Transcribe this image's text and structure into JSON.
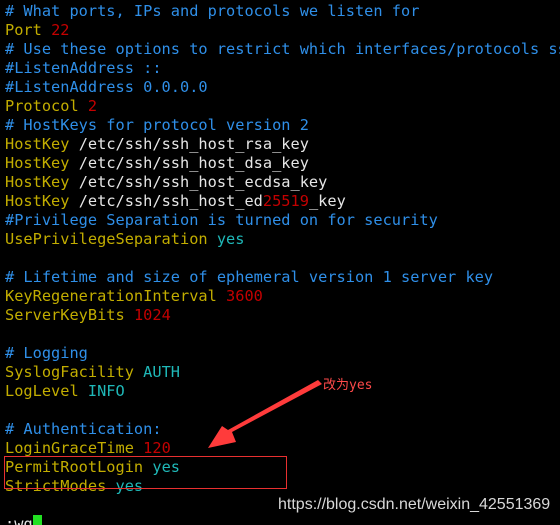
{
  "editor": {
    "lines": [
      [
        [
          "# What ports, IPs and protocols we listen for",
          "comment"
        ]
      ],
      [
        [
          "Port ",
          "keyword"
        ],
        [
          "22",
          "number"
        ]
      ],
      [
        [
          "# Use these options to restrict which interfaces/protocols sshd will bind to",
          "comment"
        ]
      ],
      [
        [
          "#ListenAddress ::",
          "comment"
        ]
      ],
      [
        [
          "#ListenAddress 0.0.0.0",
          "comment"
        ]
      ],
      [
        [
          "Protocol ",
          "keyword"
        ],
        [
          "2",
          "number"
        ]
      ],
      [
        [
          "# HostKeys for protocol version 2",
          "comment"
        ]
      ],
      [
        [
          "HostKey ",
          "keyword"
        ],
        [
          "/etc/ssh/ssh_host_rsa_key",
          "plain"
        ]
      ],
      [
        [
          "HostKey ",
          "keyword"
        ],
        [
          "/etc/ssh/ssh_host_dsa_key",
          "plain"
        ]
      ],
      [
        [
          "HostKey ",
          "keyword"
        ],
        [
          "/etc/ssh/ssh_host_ecdsa_key",
          "plain"
        ]
      ],
      [
        [
          "HostKey ",
          "keyword"
        ],
        [
          "/etc/ssh/ssh_host_ed",
          "plain"
        ],
        [
          "25519",
          "number"
        ],
        [
          "_key",
          "plain"
        ]
      ],
      [
        [
          "#Privilege Separation is turned on for security",
          "comment"
        ]
      ],
      [
        [
          "UsePrivilegeSeparation ",
          "keyword"
        ],
        [
          "yes",
          "value"
        ]
      ],
      [],
      [
        [
          "# Lifetime and size of ephemeral version 1 server key",
          "comment"
        ]
      ],
      [
        [
          "KeyRegenerationInterval ",
          "keyword"
        ],
        [
          "3600",
          "number"
        ]
      ],
      [
        [
          "ServerKeyBits ",
          "keyword"
        ],
        [
          "1024",
          "number"
        ]
      ],
      [],
      [
        [
          "# Logging",
          "comment"
        ]
      ],
      [
        [
          "SyslogFacility ",
          "keyword"
        ],
        [
          "AUTH",
          "value"
        ]
      ],
      [
        [
          "LogLevel ",
          "keyword"
        ],
        [
          "INFO",
          "value"
        ]
      ],
      [],
      [
        [
          "# Authentication:",
          "comment"
        ]
      ],
      [
        [
          "LoginGraceTime ",
          "keyword"
        ],
        [
          "120",
          "number"
        ]
      ],
      [
        [
          "PermitRootLogin ",
          "keyword"
        ],
        [
          "yes",
          "value"
        ]
      ],
      [
        [
          "StrictModes ",
          "keyword"
        ],
        [
          "yes",
          "value"
        ]
      ]
    ],
    "command": ":wq"
  },
  "annotation": {
    "note": "改为yes",
    "color": "#ff4a4a"
  },
  "watermark": "https://blog.csdn.net/weixin_42551369",
  "colors": {
    "comment": "#2f8fe8",
    "keyword": "#c2ad00",
    "number": "#c40000",
    "value": "#1fb8b8",
    "plain": "#e6e6e6",
    "cursor": "#22e022"
  }
}
